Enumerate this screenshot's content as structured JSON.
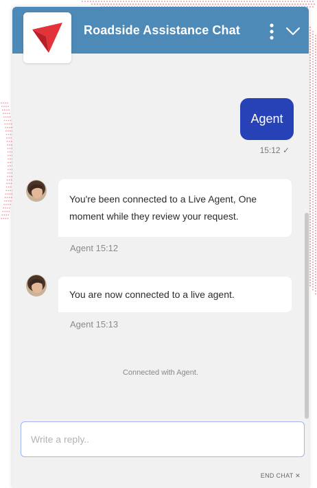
{
  "header": {
    "title": "Roadside Assistance Chat",
    "logo_icon": "red-arrow-logo",
    "menu_icon": "vertical-ellipsis-icon",
    "collapse_icon": "chevron-down-icon",
    "background_color": "#4d8ab8"
  },
  "messages": {
    "sent": {
      "text": "Agent",
      "time": "15:12 ✓",
      "bubble_color": "#2741b6"
    },
    "received": [
      {
        "text": "You're been connected to a Live Agent, One moment while they review your request.",
        "meta": "Agent 15:12"
      },
      {
        "text": "You are now connected to a live agent.",
        "meta": "Agent 15:13"
      }
    ],
    "system": "Connected with Agent."
  },
  "composer": {
    "placeholder": "Write a reply..",
    "value": ""
  },
  "footer": {
    "end_chat_label": "END CHAT ✕"
  },
  "colors": {
    "accent_red": "#e2333a",
    "dots": "#f09aa6"
  }
}
